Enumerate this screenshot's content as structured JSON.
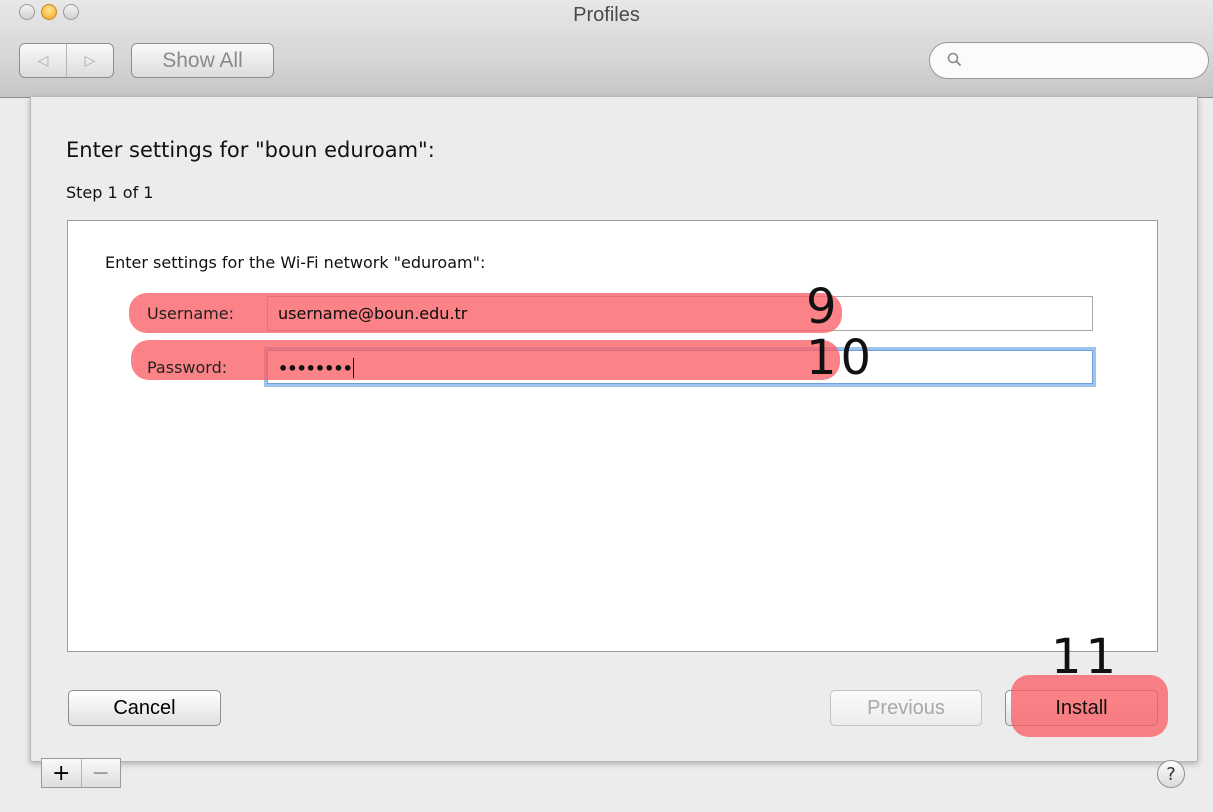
{
  "window": {
    "title": "Profiles",
    "show_all_label": "Show All",
    "back_glyph": "◁",
    "forward_glyph": "▷",
    "search_placeholder": ""
  },
  "sheet": {
    "heading": "Enter settings for \"boun eduroam\":",
    "step": "Step 1 of 1",
    "instruction": "Enter settings for the Wi-Fi network \"eduroam\":",
    "username_label": "Username:",
    "username_value": "username@boun.edu.tr",
    "password_label": "Password:",
    "password_masked": "••••••••"
  },
  "buttons": {
    "cancel": "Cancel",
    "previous": "Previous",
    "install": "Install"
  },
  "annotations": {
    "step9": "9",
    "step10": "10",
    "step11": "11"
  },
  "bottom_bar": {
    "add": "+",
    "remove": "−",
    "help": "?"
  },
  "colors": {
    "highlight": "#fa5f64",
    "focus_ring": "#9cc4ee"
  }
}
